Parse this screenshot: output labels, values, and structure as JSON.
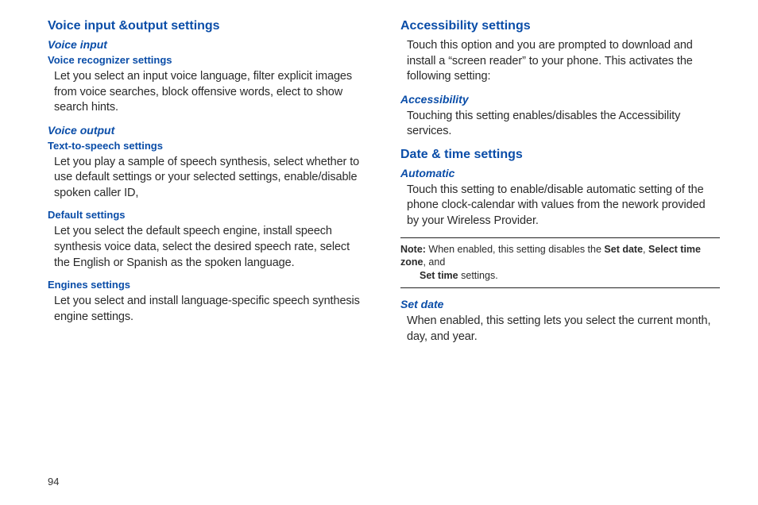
{
  "left": {
    "section_title": "Voice input &output settings",
    "voice_input": {
      "title": "Voice input",
      "recognizer": {
        "title": "Voice recognizer settings",
        "body": "Let you select an input voice language, filter explicit images from voice searches, block offensive words, elect to show search hints."
      }
    },
    "voice_output": {
      "title": "Voice output",
      "tts": {
        "title": "Text-to-speech settings",
        "body": "Let you play a sample of speech synthesis, select whether to use default settings or your selected settings, enable/disable spoken caller ID,"
      },
      "defaults": {
        "title": "Default settings",
        "body": "Let you select the default speech engine, install speech synthesis voice data, select the desired speech rate, select the English or Spanish as the spoken language."
      },
      "engines": {
        "title": "Engines settings",
        "body": "Let you select and install language-specific speech synthesis engine settings."
      }
    }
  },
  "right": {
    "accessibility": {
      "title": "Accessibility settings",
      "intro": "Touch this option and you are prompted to download and install a “screen reader” to your phone. This activates the following setting:",
      "sub": {
        "title": "Accessibility",
        "body": "Touching this setting enables/disables the Accessibility services."
      }
    },
    "datetime": {
      "title": "Date & time settings",
      "automatic": {
        "title": "Automatic",
        "body": "Touch this setting to enable/disable automatic setting of the phone clock-calendar with values from the nework provided by your Wireless Provider."
      },
      "note": {
        "lead": "Note:",
        "pre": " When enabled, this setting disables the ",
        "b1": "Set date",
        "sep1": ", ",
        "b2": "Select time zone",
        "sep2": ", and ",
        "b3": "Set time",
        "post": " settings."
      },
      "setdate": {
        "title": "Set date",
        "body": "When enabled, this setting lets you select the current month, day, and year."
      }
    }
  },
  "page_number": "94"
}
